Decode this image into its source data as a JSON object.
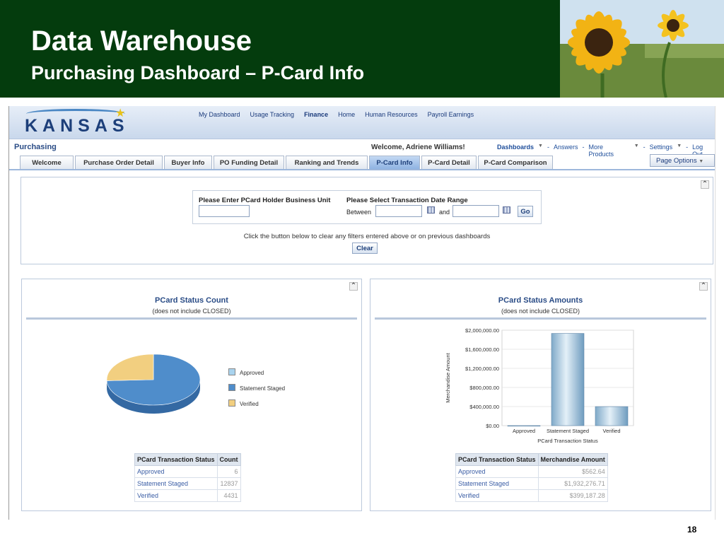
{
  "slide": {
    "title": "Data Warehouse",
    "subtitle": "Purchasing Dashboard – P-Card Info",
    "page_number": "18"
  },
  "app": {
    "logo_text": "KANSAS",
    "top_links": [
      "My Dashboard",
      "Usage Tracking",
      "Finance",
      "Home",
      "Human Resources",
      "Payroll Earnings"
    ],
    "active_top_link": "Finance",
    "section_name": "Purchasing",
    "welcome": "Welcome, Adriene Williams!",
    "global_links": {
      "dashboards": "Dashboards",
      "answers": "Answers",
      "more_products": "More Products",
      "settings": "Settings",
      "logout": "Log Out",
      "separator": "-"
    },
    "tabs": [
      "Welcome",
      "Purchase Order Detail",
      "Buyer Info",
      "PO Funding Detail",
      "Ranking and Trends",
      "P-Card Info",
      "P-Card Detail",
      "P-Card Comparison"
    ],
    "active_tab": "P-Card Info",
    "page_options": "Page Options"
  },
  "filters": {
    "business_unit_label": "Please Enter PCard Holder Business Unit",
    "business_unit_value": "",
    "date_range_label": "Please Select Transaction Date Range",
    "between_label": "Between",
    "and_label": "and",
    "start_date_value": "",
    "end_date_value": "",
    "go_button": "Go",
    "clear_message": "Click the button below to clear any filters entered above or on previous dashboards",
    "clear_button": "Clear"
  },
  "status_count": {
    "title": "PCard Status Count",
    "subtitle": "(does not include CLOSED)",
    "legend": [
      "Approved",
      "Statement Staged",
      "Verified"
    ],
    "colors": {
      "Approved": "#a9d3ee",
      "Statement Staged": "#4f8dcb",
      "Verified": "#f2cf80"
    },
    "table_headers": [
      "PCard Transaction Status",
      "Count"
    ],
    "rows": [
      {
        "status": "Approved",
        "value": "6"
      },
      {
        "status": "Statement Staged",
        "value": "12837"
      },
      {
        "status": "Verified",
        "value": "4431"
      }
    ]
  },
  "status_amounts": {
    "title": "PCard Status Amounts",
    "subtitle": "(does not include CLOSED)",
    "table_headers": [
      "PCard Transaction Status",
      "Merchandise Amount"
    ],
    "rows": [
      {
        "status": "Approved",
        "value": "$562.64"
      },
      {
        "status": "Statement Staged",
        "value": "$1,932,276.71"
      },
      {
        "status": "Verified",
        "value": "$399,187.28"
      }
    ]
  },
  "chart_data": [
    {
      "type": "pie",
      "title": "PCard Status Count",
      "subtitle": "(does not include CLOSED)",
      "categories": [
        "Approved",
        "Statement Staged",
        "Verified"
      ],
      "values": [
        6,
        12837,
        4431
      ],
      "legend": "right"
    },
    {
      "type": "bar",
      "title": "PCard Status Amounts",
      "subtitle": "(does not include CLOSED)",
      "categories": [
        "Approved",
        "Statement Staged",
        "Verified"
      ],
      "values": [
        562.64,
        1932276.71,
        399187.28
      ],
      "xlabel": "PCard Transaction Status",
      "ylabel": "Merchandise Amount",
      "ylim": [
        0,
        2000000
      ],
      "yticks": [
        0,
        400000,
        800000,
        1200000,
        1600000,
        2000000
      ],
      "ytick_labels": [
        "$0.00",
        "$400,000.00",
        "$800,000.00",
        "$1,200,000.00",
        "$1,600,000.00",
        "$2,000,000.00"
      ],
      "grid": true
    }
  ]
}
